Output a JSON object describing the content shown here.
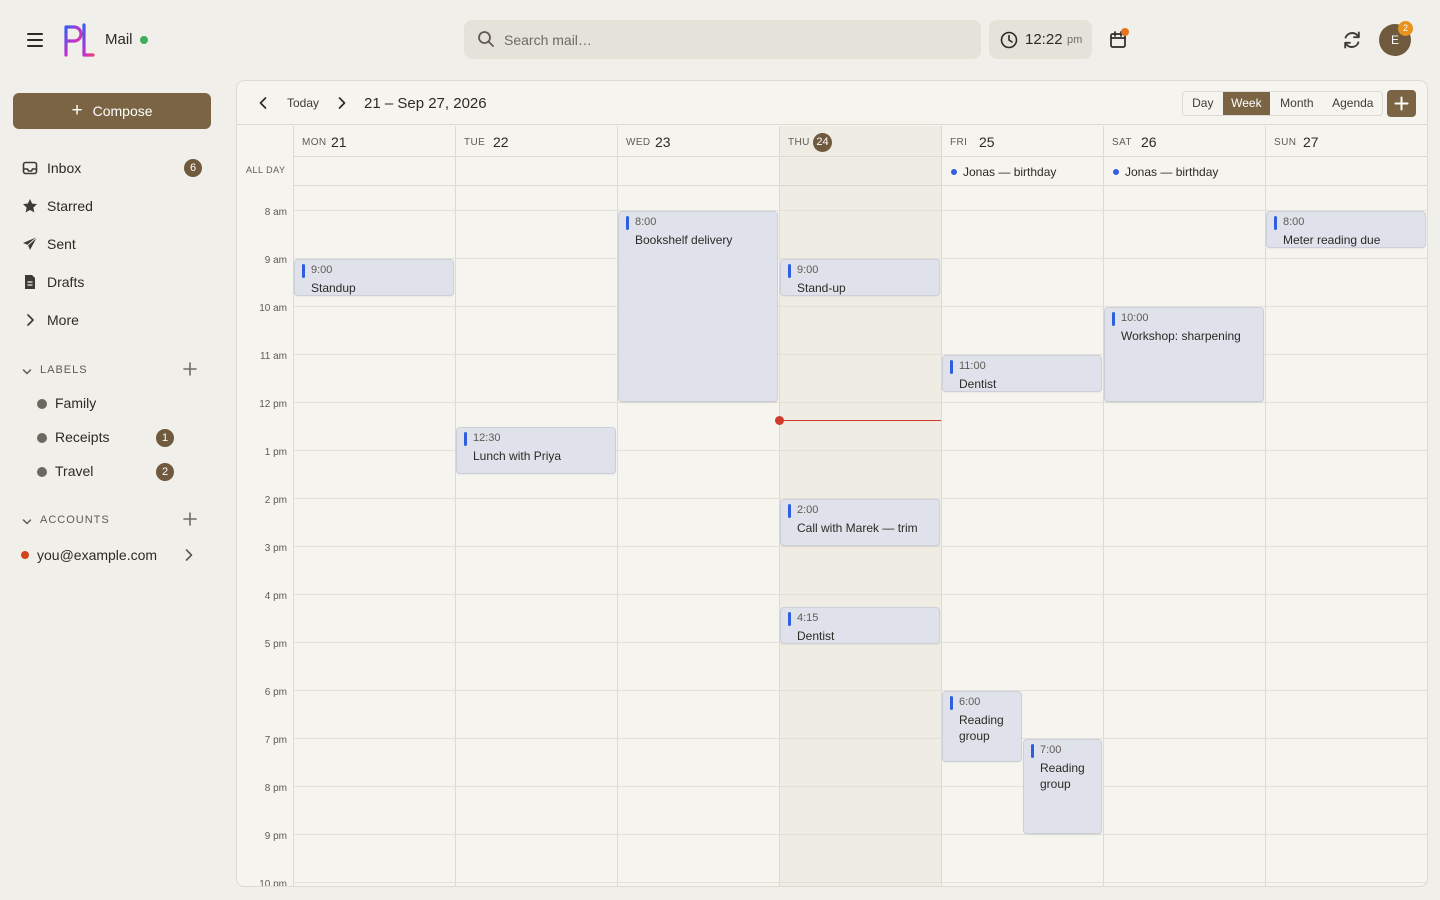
{
  "app": {
    "name": "Mail",
    "search_placeholder": "Search mail…",
    "clock_time": "12:22",
    "clock_ampm": "pm",
    "avatar_initial": "E",
    "avatar_badge": "2"
  },
  "sidebar": {
    "compose_label": "Compose",
    "nav": [
      {
        "label": "Inbox",
        "icon": "inbox-icon",
        "count": "6"
      },
      {
        "label": "Starred",
        "icon": "star-icon"
      },
      {
        "label": "Sent",
        "icon": "send-icon"
      },
      {
        "label": "Drafts",
        "icon": "draft-icon"
      },
      {
        "label": "More",
        "icon": "chevron-right-icon"
      }
    ],
    "labels_heading": "LABELS",
    "labels": [
      {
        "label": "Family"
      },
      {
        "label": "Receipts",
        "count": "1"
      },
      {
        "label": "Travel",
        "count": "2"
      }
    ],
    "accounts_heading": "ACCOUNTS",
    "account_email": "you@example.com"
  },
  "calendar": {
    "today_label": "Today",
    "range_label": "21 – Sep 27, 2026",
    "views": [
      "Day",
      "Week",
      "Month",
      "Agenda"
    ],
    "active_view": "Week",
    "all_day_label": "ALL DAY",
    "days": [
      {
        "dow": "MON",
        "num": "21"
      },
      {
        "dow": "TUE",
        "num": "22"
      },
      {
        "dow": "WED",
        "num": "23"
      },
      {
        "dow": "THU",
        "num": "24",
        "today": true
      },
      {
        "dow": "FRI",
        "num": "25"
      },
      {
        "dow": "SAT",
        "num": "26"
      },
      {
        "dow": "SUN",
        "num": "27"
      }
    ],
    "hours": [
      "8 am",
      "9 am",
      "10 am",
      "11 am",
      "12 pm",
      "1 pm",
      "2 pm",
      "3 pm",
      "4 pm",
      "5 pm",
      "6 pm",
      "7 pm",
      "8 pm",
      "9 pm",
      "10 pm"
    ],
    "all_day_events": [
      {
        "title": "Jonas — birthday",
        "day": "FRI"
      },
      {
        "title": "Jonas — birthday",
        "day": "SAT"
      }
    ],
    "events": [
      {
        "time": "9:00",
        "title": "Standup"
      },
      {
        "time": "12:30",
        "title": "Lunch with Priya"
      },
      {
        "time": "8:00",
        "title": "Bookshelf delivery"
      },
      {
        "time": "9:00",
        "title": "Stand-up"
      },
      {
        "time": "2:00",
        "title": "Call with Marek — trim"
      },
      {
        "time": "4:15",
        "title": "Dentist"
      },
      {
        "time": "11:00",
        "title": "Dentist"
      },
      {
        "time": "6:00",
        "title": "Reading group"
      },
      {
        "time": "7:00",
        "title": "Reading group"
      },
      {
        "time": "10:00",
        "title": "Workshop: sharpening"
      },
      {
        "time": "8:00",
        "title": "Meter reading due"
      }
    ],
    "event_color": "#2f5fe0",
    "now_line_color": "#d23a2e"
  }
}
